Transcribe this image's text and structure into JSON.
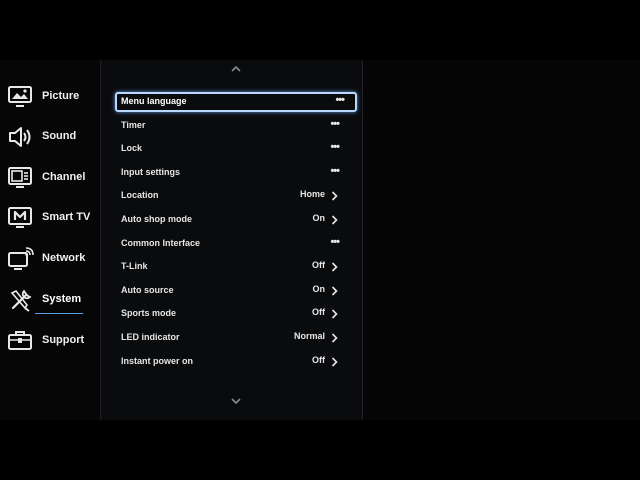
{
  "sidebar": {
    "items": [
      {
        "label": "Picture",
        "icon": "picture-icon"
      },
      {
        "label": "Sound",
        "icon": "speaker-icon"
      },
      {
        "label": "Channel",
        "icon": "tv-channel-icon"
      },
      {
        "label": "Smart TV",
        "icon": "smart-tv-icon"
      },
      {
        "label": "Network",
        "icon": "network-icon"
      },
      {
        "label": "System",
        "icon": "tools-icon",
        "active": true
      },
      {
        "label": "Support",
        "icon": "toolbox-icon"
      }
    ]
  },
  "menu": {
    "items": [
      {
        "label": "Menu language",
        "value": "",
        "control": "more",
        "glyph": "•••",
        "focused": true
      },
      {
        "label": "Timer",
        "value": "",
        "control": "more",
        "glyph": "•••"
      },
      {
        "label": "Lock",
        "value": "",
        "control": "more",
        "glyph": "•••"
      },
      {
        "label": "Input settings",
        "value": "",
        "control": "more",
        "glyph": "•••"
      },
      {
        "label": "Location",
        "value": "Home",
        "control": "chevron"
      },
      {
        "label": "Auto shop mode",
        "value": "On",
        "control": "chevron"
      },
      {
        "label": "Common Interface",
        "value": "",
        "control": "more",
        "glyph": "•••"
      },
      {
        "label": "T-Link",
        "value": "Off",
        "control": "chevron"
      },
      {
        "label": "Auto source",
        "value": "On",
        "control": "chevron"
      },
      {
        "label": "Sports mode",
        "value": "Off",
        "control": "chevron"
      },
      {
        "label": "LED indicator",
        "value": "Normal",
        "control": "chevron"
      },
      {
        "label": "Instant power on",
        "value": "Off",
        "control": "chevron"
      }
    ]
  },
  "colors": {
    "accent": "#5a9fe0",
    "focus_border": "#b9d7ff",
    "background": "#050506",
    "text": "#e6e6e6"
  }
}
